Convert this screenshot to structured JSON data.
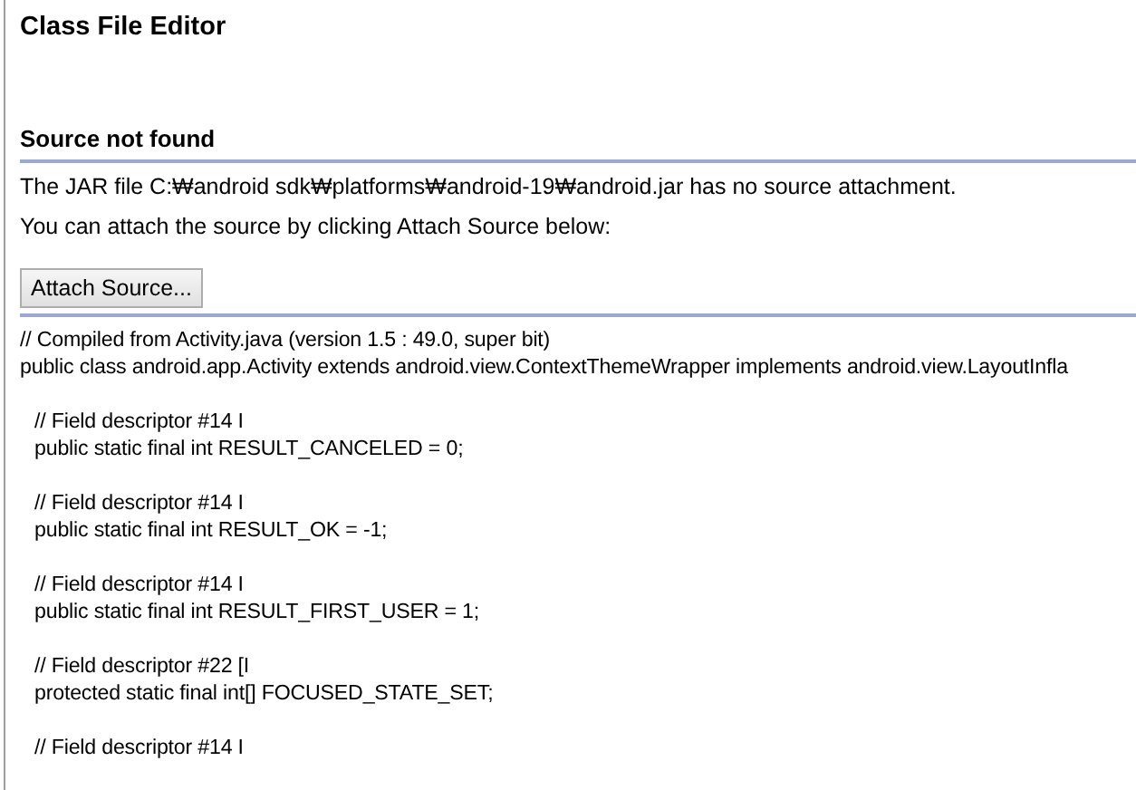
{
  "editor": {
    "title": "Class File Editor"
  },
  "section": {
    "heading": "Source not found",
    "messages": [
      "The JAR file C:₩android sdk₩platforms₩android-19₩android.jar has no source attachment.",
      "You can attach the source by clicking Attach Source below:"
    ],
    "button": "Attach Source..."
  },
  "code": {
    "header": [
      "// Compiled from Activity.java (version 1.5 : 49.0, super bit)",
      "public class android.app.Activity extends android.view.ContextThemeWrapper implements android.view.LayoutInfla"
    ],
    "fields": [
      {
        "comment": "// Field descriptor #14 I",
        "declaration": "public static final int RESULT_CANCELED = 0;"
      },
      {
        "comment": "// Field descriptor #14 I",
        "declaration": "public static final int RESULT_OK = -1;"
      },
      {
        "comment": "// Field descriptor #14 I",
        "declaration": "public static final int RESULT_FIRST_USER = 1;"
      },
      {
        "comment": "// Field descriptor #22 [I",
        "declaration": "protected static final int[] FOCUSED_STATE_SET;"
      },
      {
        "comment": "// Field descriptor #14 I"
      }
    ]
  }
}
